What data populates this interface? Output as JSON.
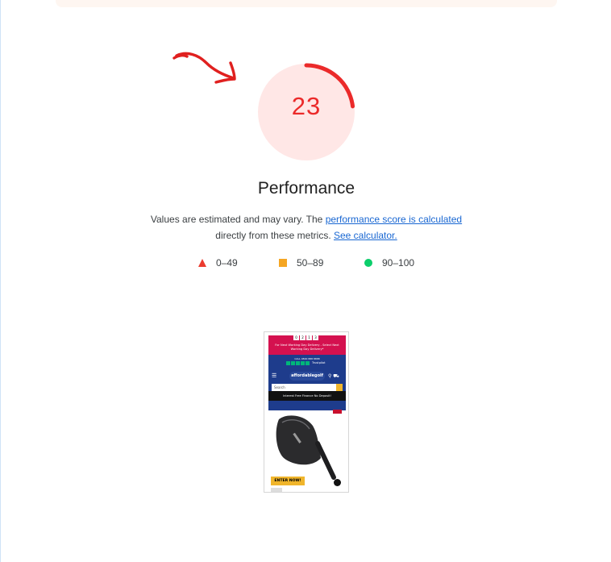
{
  "gauge": {
    "score": "23",
    "score_value": 23,
    "title": "Performance",
    "fail_color": "#eb2a2a"
  },
  "description": {
    "text_1": "Values are estimated and may vary. The",
    "link_1": "performance score is calculated",
    "text_2": "directly from these metrics.",
    "link_2": "See calculator."
  },
  "legend": [
    {
      "label": "0–49",
      "shape": "triangle-icon",
      "color": "#eb3b2f"
    },
    {
      "label": "50–89",
      "shape": "square-icon",
      "color": "#f5a623"
    },
    {
      "label": "90–100",
      "shape": "circle-icon",
      "color": "#0cce6b"
    }
  ],
  "thumbnail": {
    "countdown": [
      "0",
      "2",
      "1",
      "3"
    ],
    "delivery_text": "For Next Working Day Delivery - Select Next Working Day Delivery*",
    "call_text": "CALL 0800 888 8888",
    "trustpilot": "Trustpilot",
    "logo": "affordablegolf",
    "search_placeholder": "Search",
    "promo_text": "Interest Free Finance No Deposit!",
    "cta": "ENTER NOW!"
  }
}
